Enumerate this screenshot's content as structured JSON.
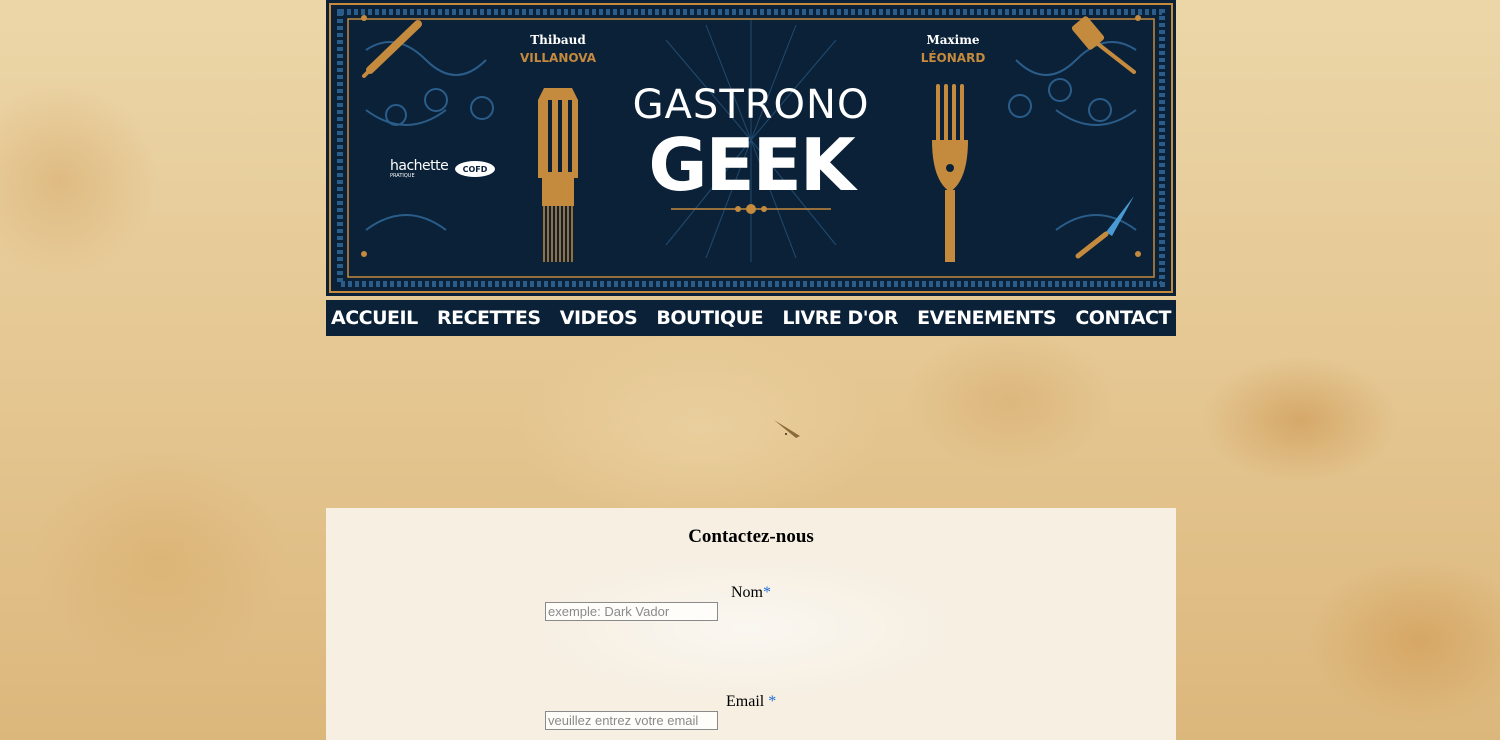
{
  "banner": {
    "author_left_first": "Thibaud",
    "author_left_last": "VILLANOVA",
    "author_right_first": "Maxime",
    "author_right_last": "LÉONARD",
    "title_top": "GASTRONO",
    "title_bottom": "GEEK",
    "publisher": "hachette",
    "publisher_sub": "PRATIQUE",
    "partner": "COFD",
    "colors": {
      "navy": "#0b2138",
      "gold": "#c48a3e",
      "blue": "#2a5d8a"
    }
  },
  "nav": {
    "items": [
      "ACCUEIL",
      "RECETTES",
      "VIDEOS",
      "BOUTIQUE",
      "LIVRE D'OR",
      "EVENEMENTS",
      "CONTACT"
    ]
  },
  "form": {
    "title": "Contactez-nous",
    "required_mark": "*",
    "name_label": "Nom",
    "name_placeholder": "exemple: Dark Vador",
    "email_label": "Email",
    "email_placeholder": "veuillez entrez votre email"
  }
}
